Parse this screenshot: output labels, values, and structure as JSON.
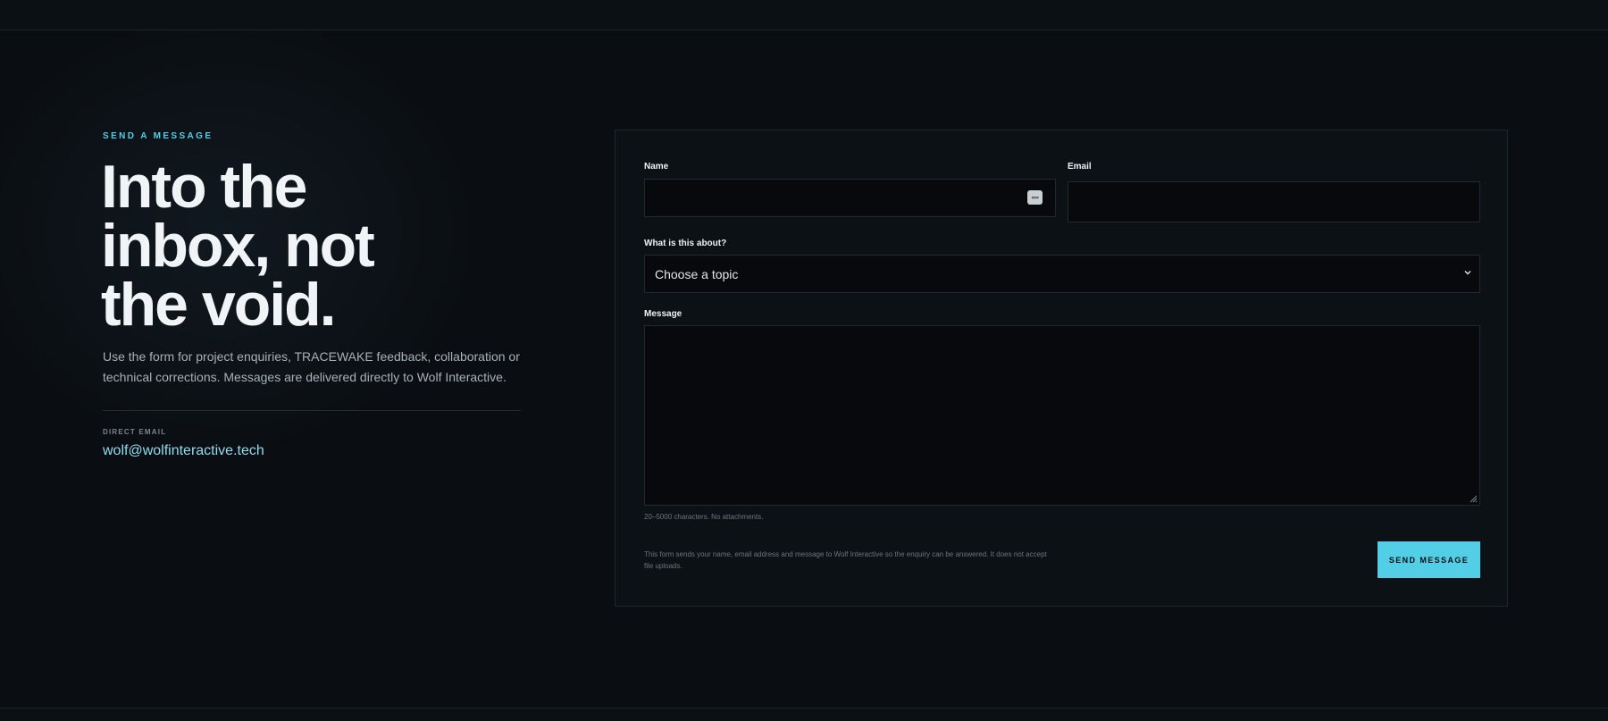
{
  "hero": {
    "eyebrow": "SEND A MESSAGE",
    "headline_line1": "Into the",
    "headline_line2": "inbox, not",
    "headline_line3": "the void.",
    "lead": "Use the form for project enquiries, TRACEWAKE feedback, collaboration or technical corrections. Messages are delivered directly to Wolf Interactive.",
    "direct_label": "DIRECT EMAIL",
    "direct_email": "wolf@wolfinteractive.tech"
  },
  "form": {
    "name_label": "Name",
    "name_value": "",
    "email_label": "Email",
    "email_value": "",
    "topic_label": "What is this about?",
    "topic_selected": "Choose a topic",
    "message_label": "Message",
    "message_value": "",
    "message_hint": "20–5000 characters. No attachments.",
    "privacy_note": "This form sends your name, email address and message to Wolf Interactive so the enquiry can be answered. It does not accept file uploads.",
    "submit_label": "SEND MESSAGE"
  },
  "colors": {
    "accent": "#52cfe6",
    "background": "#0a0e12",
    "card": "#0c1116",
    "field": "#07090c"
  },
  "icons": {
    "autofill": "autofill-key-icon",
    "select": "chevron-down-icon",
    "resize": "resize-grip-icon"
  }
}
